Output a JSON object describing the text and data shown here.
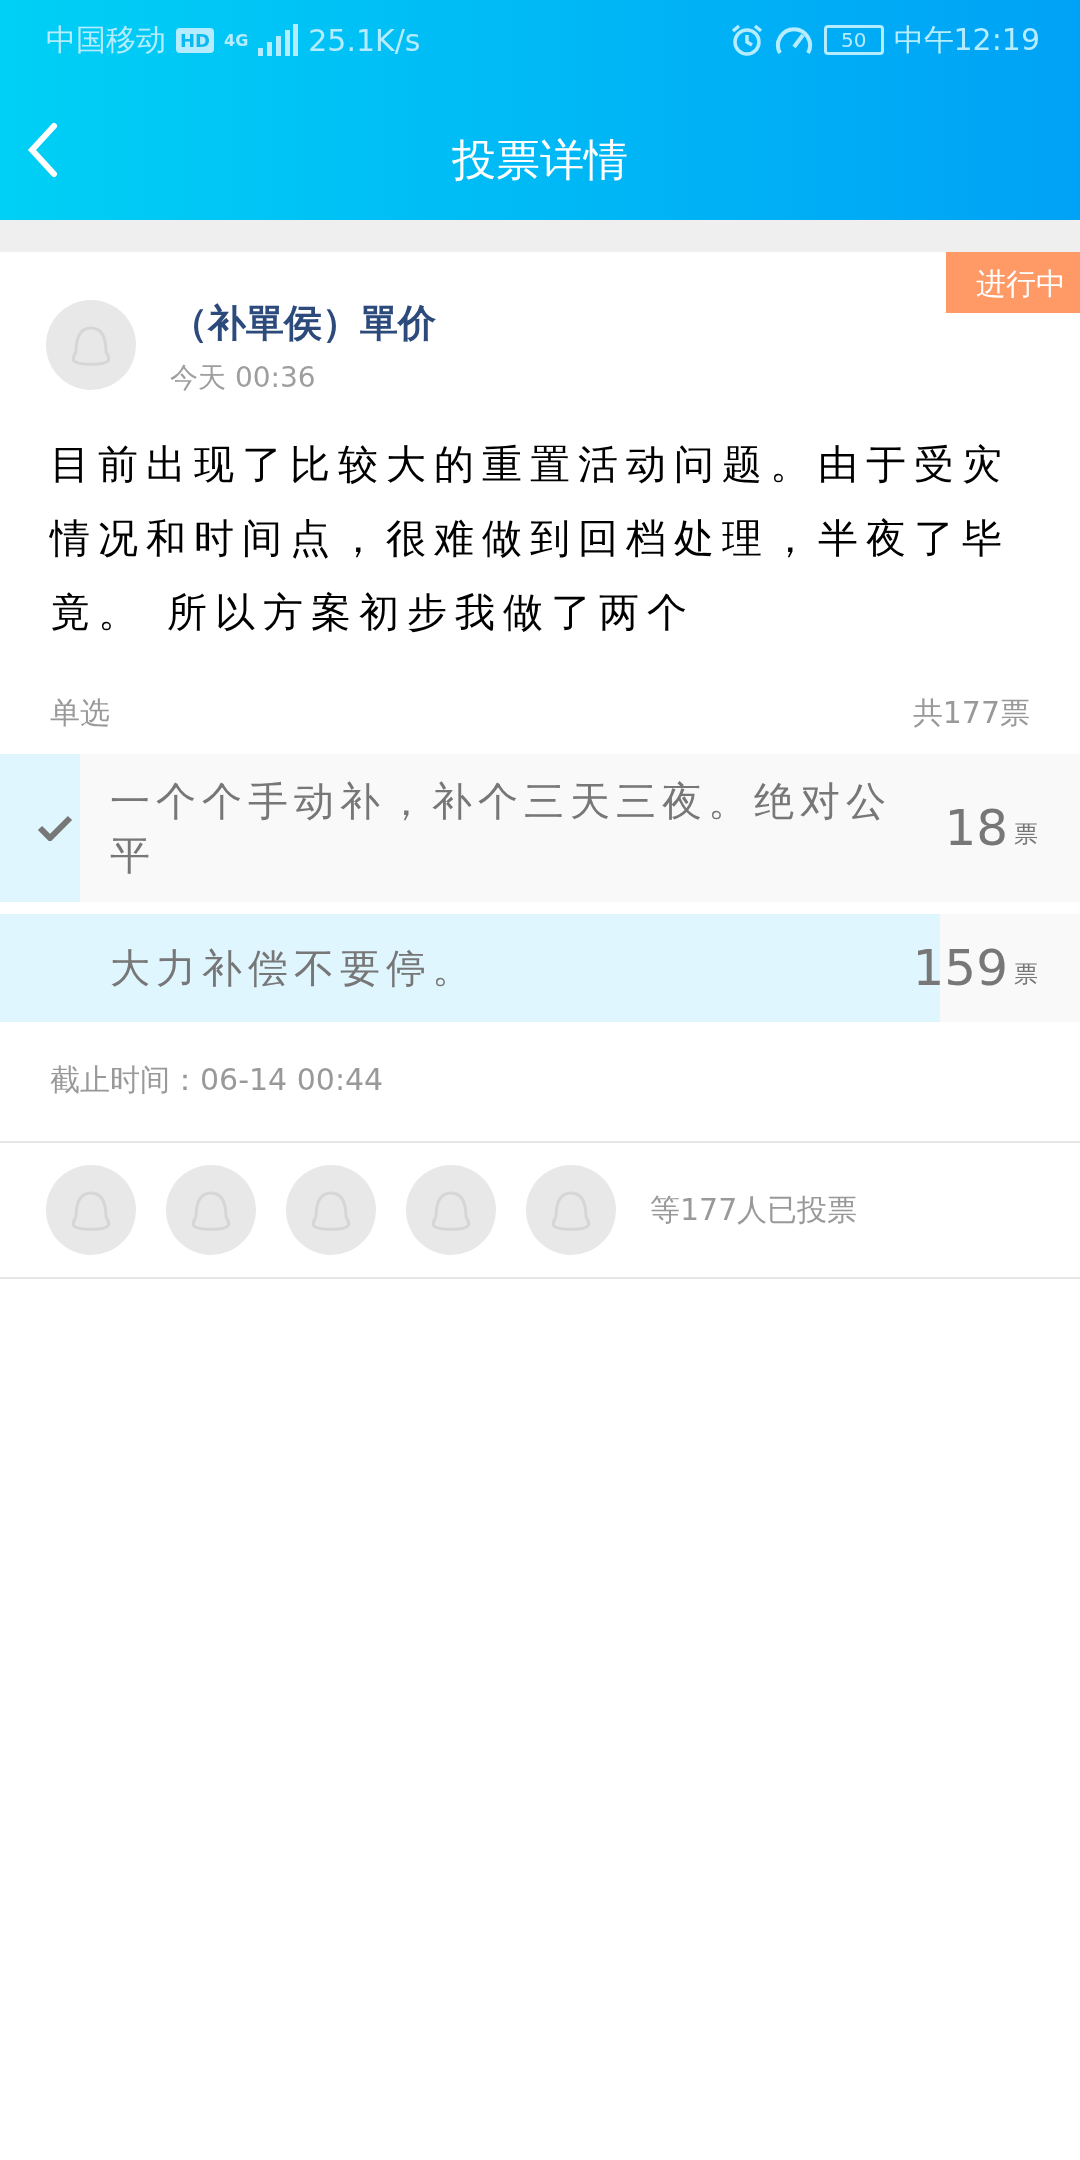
{
  "status_bar": {
    "carrier": "中国移动",
    "hd": "HD",
    "network": "4G",
    "speed": "25.1K/s",
    "battery": "50",
    "time": "中午12:19"
  },
  "header": {
    "title": "投票详情"
  },
  "poll": {
    "status": "进行中",
    "author": "（补單侯）單价",
    "time": "今天 00:36",
    "body": "目前出现了比较大的重置活动问题。由于受灾情况和时间点，很难做到回档处理，半夜了毕竟。 所以方案初步我做了两个",
    "type": "单选",
    "total": "共177票",
    "options": [
      {
        "text": "一个个手动补，补个三天三夜。绝对公平",
        "count": "18",
        "unit": "票",
        "level": 0.074,
        "selected": true
      },
      {
        "text": "大力补偿不要停。",
        "count": "159",
        "unit": "票",
        "level": 0.87,
        "selected": false
      }
    ],
    "deadline": "截止时间：06-14 00:44",
    "voters": [
      {
        "kind": "avatar"
      },
      {
        "kind": "avatar"
      },
      {
        "kind": "avatar"
      },
      {
        "kind": "avatar"
      },
      {
        "kind": "avatar"
      }
    ],
    "voters_text": "等177人已投票"
  }
}
